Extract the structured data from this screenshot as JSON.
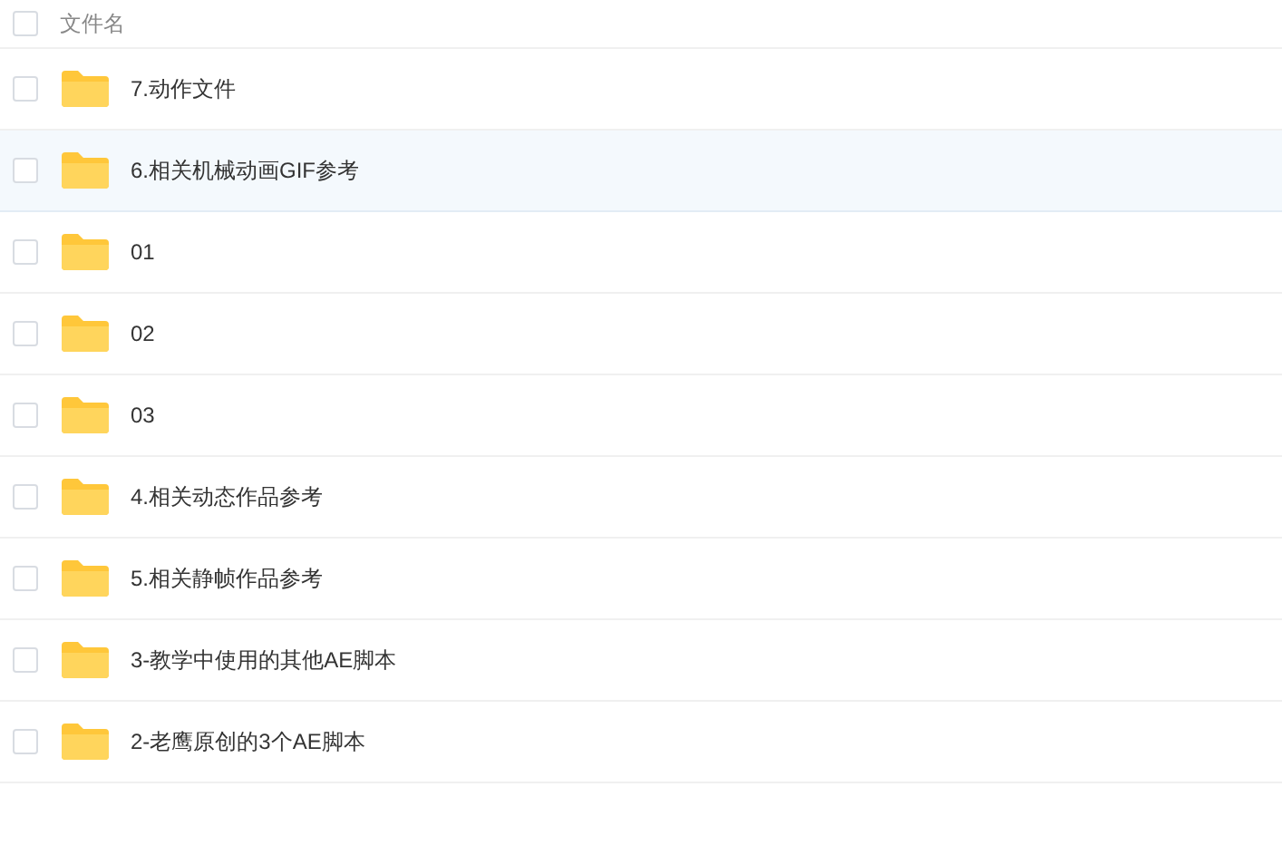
{
  "header": {
    "checked": false,
    "label": "文件名"
  },
  "files": [
    {
      "name": "7.动作文件",
      "checked": false,
      "selected": false
    },
    {
      "name": "6.相关机械动画GIF参考",
      "checked": false,
      "selected": true
    },
    {
      "name": "01",
      "checked": false,
      "selected": false
    },
    {
      "name": "02",
      "checked": false,
      "selected": false
    },
    {
      "name": "03",
      "checked": false,
      "selected": false
    },
    {
      "name": "4.相关动态作品参考",
      "checked": false,
      "selected": false
    },
    {
      "name": "5.相关静帧作品参考",
      "checked": false,
      "selected": false
    },
    {
      "name": "3-教学中使用的其他AE脚本",
      "checked": false,
      "selected": false
    },
    {
      "name": "2-老鹰原创的3个AE脚本",
      "checked": false,
      "selected": false
    }
  ]
}
